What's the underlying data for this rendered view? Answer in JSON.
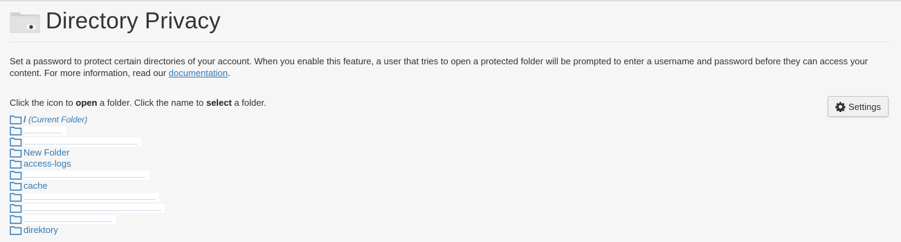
{
  "header": {
    "title": "Directory Privacy",
    "icon": "folder-eye-icon"
  },
  "intro": {
    "text_before": "Set a password to protect certain directories of your account. When you enable this feature, a user that tries to open a protected folder will be prompted to enter a username and password before they can access your content. For more information, read our ",
    "link_label": "documentation",
    "text_after": "."
  },
  "instructions": {
    "part1": "Click the icon to ",
    "bold1": "open",
    "part2": " a folder. Click the name to ",
    "bold2": "select",
    "part3": " a folder."
  },
  "settings_button": {
    "label": "Settings",
    "icon": "gear-icon"
  },
  "folders": {
    "current_slash": "/",
    "current_label": " (Current Folder)",
    "f3": "New Folder",
    "f4": "access-logs",
    "f6": "cache",
    "f11": "direktory"
  },
  "colors": {
    "link": "#337ab7",
    "background": "#f6f6f6",
    "text": "#333333"
  }
}
